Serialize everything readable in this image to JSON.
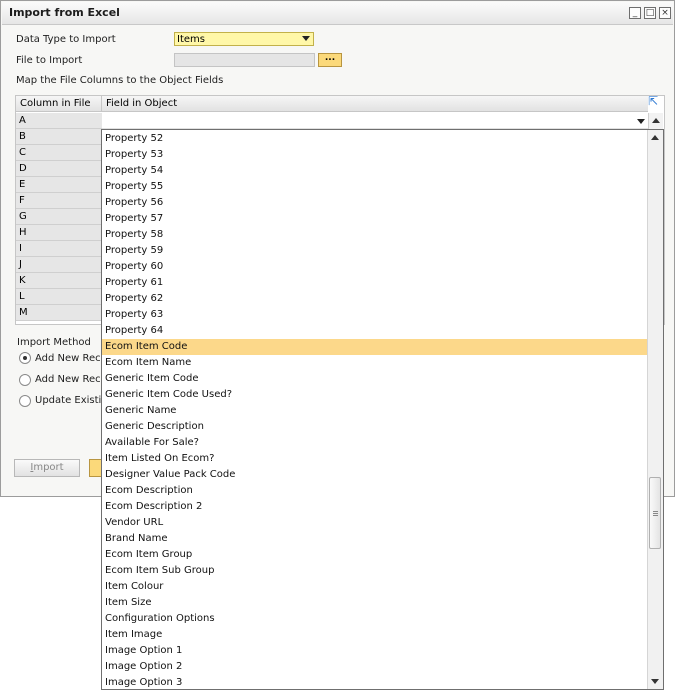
{
  "window": {
    "title": "Import from Excel"
  },
  "form": {
    "data_type_label": "Data Type to Import",
    "data_type_value": "Items",
    "file_label": "File to Import",
    "browse_label": "...",
    "map_label": "Map the File Columns to the Object Fields"
  },
  "grid": {
    "col_header": "Column in File",
    "field_header": "Field in Object",
    "rows": [
      "A",
      "B",
      "C",
      "D",
      "E",
      "F",
      "G",
      "H",
      "I",
      "J",
      "K",
      "L",
      "M"
    ]
  },
  "import_method": {
    "label": "Import Method",
    "options": [
      "Add New Reco",
      "Add New Reco",
      "Update Existing"
    ],
    "selected": 0
  },
  "buttons": {
    "import_label": "Import"
  },
  "dropdown": {
    "items": [
      "Property 52",
      "Property 53",
      "Property 54",
      "Property 55",
      "Property 56",
      "Property 57",
      "Property 58",
      "Property 59",
      "Property 60",
      "Property 61",
      "Property 62",
      "Property 63",
      "Property 64",
      "Ecom Item Code",
      "Ecom Item Name",
      "Generic Item Code",
      "Generic Item Code Used?",
      "Generic Name",
      "Generic Description",
      "Available For Sale?",
      "Item Listed On Ecom?",
      "Designer Value Pack Code",
      "Ecom Description",
      "Ecom Description 2",
      "Vendor URL",
      "Brand Name",
      "Ecom Item Group",
      "Ecom Item Sub Group",
      "Item Colour",
      "Item Size",
      "Configuration Options",
      "Item Image",
      "Image Option 1",
      "Image Option 2",
      "Image Option 3"
    ],
    "selected_index": 13
  },
  "colors": {
    "highlight": "#fcd88a",
    "combo": "#fff7a8",
    "accent_button": "#fbd97a"
  }
}
